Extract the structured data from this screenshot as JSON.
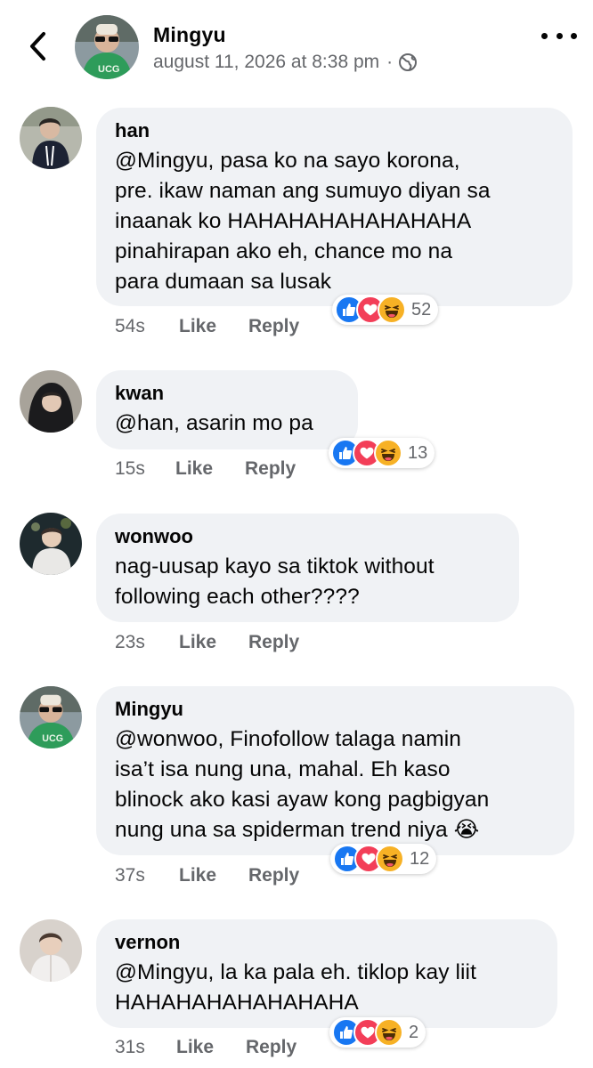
{
  "post": {
    "author": "Mingyu",
    "timestamp": "august 11, 2026 at 8:38 pm",
    "separator": "·",
    "privacy_icon": "globe-icon"
  },
  "header": {
    "back_icon": "chevron-left-icon",
    "more_icon": "more-dots-icon"
  },
  "labels": {
    "like": "Like",
    "reply": "Reply"
  },
  "comments": [
    {
      "author": "han",
      "text": "@Mingyu, pasa ko na sayo korona,\npre. ikaw naman ang sumuyo diyan sa\ninaanak ko HAHAHAHAHAHAHAHA\npinahirapan ako eh, chance mo na\npara dumaan sa lusak",
      "time": "54s",
      "reactions": [
        "like",
        "love",
        "haha"
      ],
      "reaction_count": "52"
    },
    {
      "author": "kwan",
      "text": "@han, asarin mo pa",
      "time": "15s",
      "reactions": [
        "like",
        "love",
        "haha"
      ],
      "reaction_count": "13"
    },
    {
      "author": "wonwoo",
      "text": "nag-uusap kayo sa tiktok without\nfollowing each other????",
      "time": "23s",
      "reactions": [],
      "reaction_count": ""
    },
    {
      "author": "Mingyu",
      "text": "@wonwoo, Finofollow talaga namin\nisa’t isa nung una, mahal. Eh kaso\nblinock ako kasi ayaw kong pagbigyan\nnung una sa spiderman trend niya 😭",
      "time": "37s",
      "reactions": [
        "like",
        "love",
        "haha"
      ],
      "reaction_count": "12"
    },
    {
      "author": "vernon",
      "text": "@Mingyu, la ka pala eh. tiklop kay liit\nHAHAHAHAHAHAHAHA",
      "time": "31s",
      "reactions": [
        "like",
        "love",
        "haha"
      ],
      "reaction_count": "2"
    }
  ],
  "colors": {
    "bubble": "#f0f2f5",
    "meta_gray": "#65676b",
    "like_blue": "#1877f2",
    "love_red": "#f33e58",
    "haha_yellow": "#f7b125"
  }
}
